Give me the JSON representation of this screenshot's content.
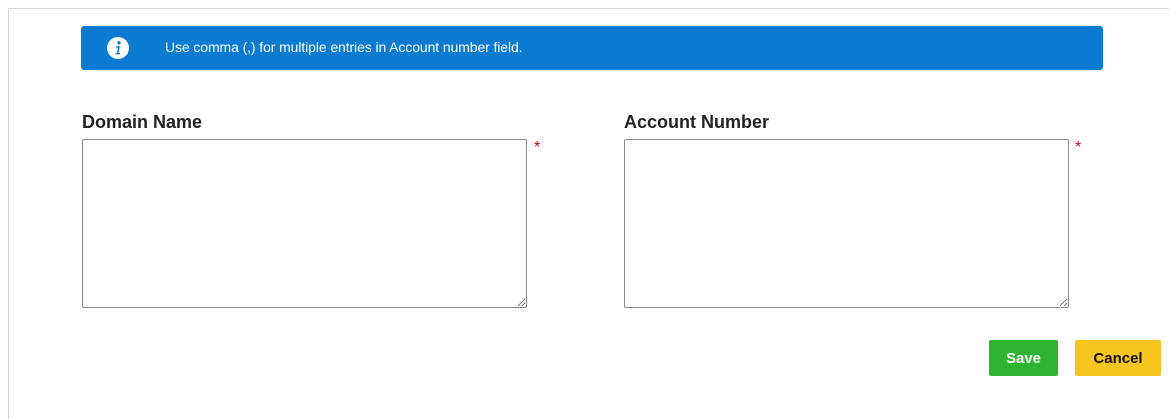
{
  "banner": {
    "message": "Use comma (,) for multiple entries in Account number field.",
    "icon": "info-icon",
    "background_color": "#0a7bd0"
  },
  "form": {
    "domain_name": {
      "label": "Domain Name",
      "value": "",
      "required_marker": "*"
    },
    "account_number": {
      "label": "Account Number",
      "value": "",
      "required_marker": "*"
    }
  },
  "actions": {
    "save_label": "Save",
    "save_color": "#2db532",
    "cancel_label": "Cancel",
    "cancel_color": "#f7c51e"
  }
}
